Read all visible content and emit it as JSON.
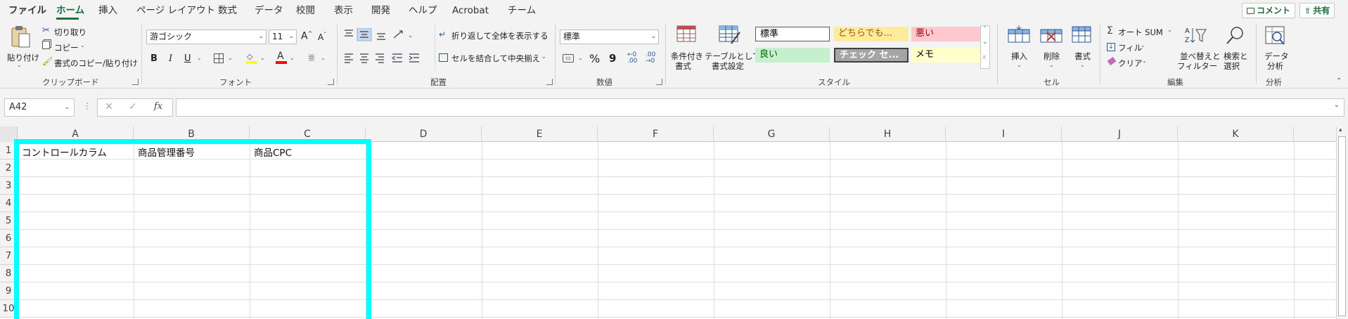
{
  "tabs": {
    "file": "ファイル",
    "home": "ホーム",
    "insert": "挿入",
    "page_layout": "ページ レイアウト",
    "formulas": "数式",
    "data": "データ",
    "review": "校閲",
    "view": "表示",
    "developer": "開発",
    "help": "ヘルプ",
    "acrobat": "Acrobat",
    "team": "チーム"
  },
  "top_buttons": {
    "comments": "コメント",
    "share": "共有"
  },
  "clipboard": {
    "paste": "貼り付け",
    "cut": "切り取り",
    "copy": "コピー",
    "format_painter": "書式のコピー/貼り付け",
    "label": "クリップボード"
  },
  "font": {
    "name": "游ゴシック",
    "size": "11",
    "bold": "B",
    "italic": "I",
    "underline": "U",
    "grow": "A",
    "shrink": "A",
    "label": "フォント"
  },
  "alignment": {
    "wrap_text": "折り返して全体を表示する",
    "merge_center": "セルを結合して中央揃え",
    "label": "配置"
  },
  "number": {
    "format": "標準",
    "percent": "%",
    "comma": "9",
    "label": "数値"
  },
  "styles": {
    "conditional": "条件付き\n書式",
    "conditional_l1": "条件付き",
    "conditional_l2": "書式",
    "table_l1": "テーブルとして",
    "table_l2": "書式設定",
    "cells": [
      {
        "text": "標準",
        "bg": "#ffffff",
        "fg": "#000000"
      },
      {
        "text": "どちらでも...",
        "bg": "#ffeb9c",
        "fg": "#9c5700"
      },
      {
        "text": "悪い",
        "bg": "#ffc7ce",
        "fg": "#9c0006"
      },
      {
        "text": "良い",
        "bg": "#c6efce",
        "fg": "#006100"
      },
      {
        "text": "チェック セ...",
        "bg": "#a5a5a5",
        "fg": "#ffffff"
      },
      {
        "text": "メモ",
        "bg": "#ffffcc",
        "fg": "#000000"
      }
    ],
    "label": "スタイル"
  },
  "cells_group": {
    "insert": "挿入",
    "delete": "削除",
    "format": "書式",
    "label": "セル"
  },
  "editing": {
    "autosum": "オート SUM",
    "fill": "フィル",
    "clear": "クリア",
    "sort_l1": "並べ替えと",
    "sort_l2": "フィルター",
    "find_l1": "検索と",
    "find_l2": "選択",
    "label": "編集"
  },
  "analysis": {
    "data_l1": "データ",
    "data_l2": "分析",
    "label": "分析"
  },
  "formula_bar": {
    "name_box": "A42",
    "fx": "fx",
    "formula": ""
  },
  "columns": [
    "A",
    "B",
    "C",
    "D",
    "E",
    "F",
    "G",
    "H",
    "I",
    "J",
    "K"
  ],
  "rows": [
    "1",
    "2",
    "3",
    "4",
    "5",
    "6",
    "7",
    "8",
    "9",
    "10"
  ],
  "cells": {
    "A1": "コントロールカラム",
    "B1": "商品管理番号",
    "C1": "商品CPC"
  },
  "colors": {
    "accent": "#1e7145",
    "highlight": "#00ffff"
  }
}
